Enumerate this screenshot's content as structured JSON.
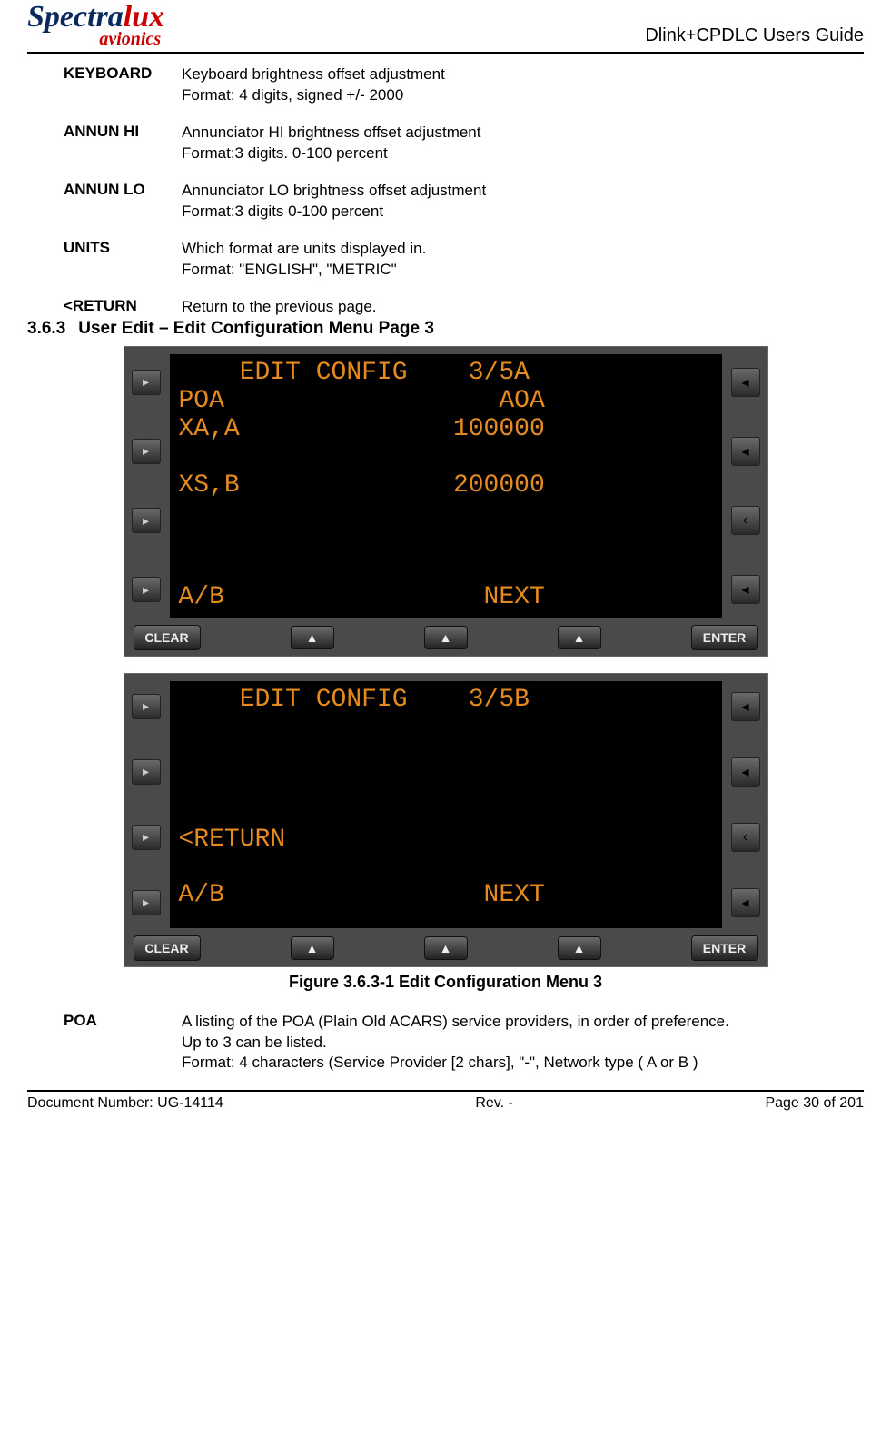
{
  "header": {
    "logo_spectra": "Spectra",
    "logo_lux": "lux",
    "logo_sub": "avionics",
    "doc_title": "Dlink+CPDLC Users Guide"
  },
  "defs_top": [
    {
      "term": "KEYBOARD",
      "lines": [
        "Keyboard brightness offset adjustment",
        "Format: 4 digits, signed +/- 2000"
      ]
    },
    {
      "term": "ANNUN HI",
      "lines": [
        "Annunciator HI brightness offset adjustment",
        "Format:3 digits.  0-100 percent"
      ]
    },
    {
      "term": "ANNUN LO",
      "lines": [
        "Annunciator LO brightness offset adjustment",
        "Format:3 digits  0-100 percent"
      ]
    },
    {
      "term": "UNITS",
      "lines": [
        "Which format are units displayed in.",
        "Format: \"ENGLISH\", \"METRIC\""
      ]
    },
    {
      "term": "<RETURN",
      "lines": [
        "Return to the previous page."
      ]
    }
  ],
  "section": {
    "num": "3.6.3",
    "title": "User Edit – Edit Configuration Menu Page 3"
  },
  "cdu_a": {
    "title_left": "EDIT CONFIG",
    "title_right": "3/5A",
    "rows": [
      {
        "l": "POA",
        "r": "AOA"
      },
      {
        "l": "XA,A",
        "r": "100000"
      },
      {
        "l": "",
        "r": ""
      },
      {
        "l": "XS,B",
        "r": "200000"
      },
      {
        "l": "",
        "r": ""
      },
      {
        "l": "",
        "r": ""
      },
      {
        "l": "",
        "r": ""
      },
      {
        "l": "A/B",
        "r": "NEXT"
      }
    ]
  },
  "cdu_b": {
    "title_left": "EDIT CONFIG",
    "title_right": "3/5B",
    "rows": [
      {
        "l": "",
        "r": ""
      },
      {
        "l": "",
        "r": ""
      },
      {
        "l": "",
        "r": ""
      },
      {
        "l": "",
        "r": ""
      },
      {
        "l": "<RETURN",
        "r": ""
      },
      {
        "l": "",
        "r": ""
      },
      {
        "l": "A/B",
        "r": "NEXT"
      }
    ]
  },
  "keys": {
    "clear": "CLEAR",
    "enter": "ENTER",
    "up": "▲",
    "chev": "‹"
  },
  "caption": "Figure 3.6.3-1 Edit Configuration Menu 3",
  "defs_bottom": [
    {
      "term": "POA",
      "lines": [
        "A listing of the POA (Plain Old ACARS) service providers, in order of preference.",
        "Up to 3 can be listed.",
        "Format: 4 characters (Service Provider [2 chars], \"-\", Network type ( A or B )"
      ]
    }
  ],
  "footer": {
    "left": "Document Number:  UG-14114",
    "center": "Rev. -",
    "right": "Page 30 of 201"
  }
}
